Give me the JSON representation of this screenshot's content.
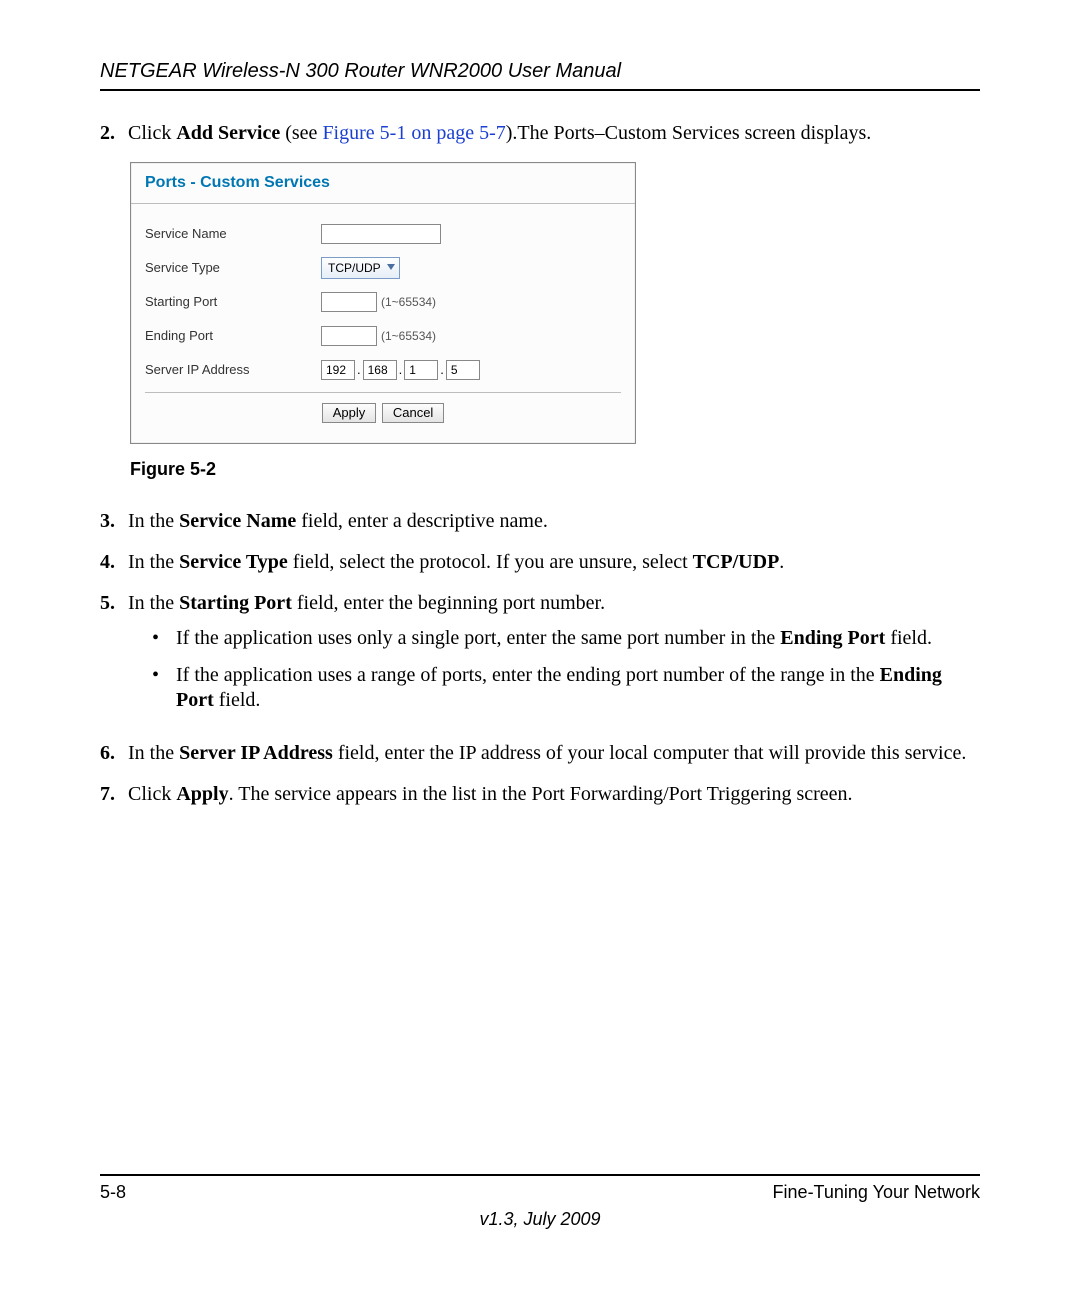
{
  "header": "NETGEAR Wireless-N 300 Router WNR2000 User Manual",
  "steps": {
    "s2": {
      "num": "2.",
      "prefix": "Click ",
      "bold1": "Add Service",
      "mid": " (see ",
      "xref": "Figure 5-1 on page 5-7",
      "suffix": ").The Ports–Custom Services screen displays."
    },
    "s3": {
      "num": "3.",
      "t1": "In the ",
      "b1": "Service Name",
      "t2": " field, enter a descriptive name."
    },
    "s4": {
      "num": "4.",
      "t1": "In the ",
      "b1": "Service Type",
      "t2": " field, select the protocol. If you are unsure, select ",
      "b2": "TCP/UDP",
      "t3": "."
    },
    "s5": {
      "num": "5.",
      "t1": "In the ",
      "b1": "Starting Port",
      "t2": " field, enter the beginning port number.",
      "bullet1": {
        "t1": "If the application uses only a single port, enter the same port number in the ",
        "b1": "Ending Port",
        "t2": " field."
      },
      "bullet2": {
        "t1": "If the application uses a range of ports, enter the ending port number of the range in the ",
        "b1": "Ending Port",
        "t2": " field."
      }
    },
    "s6": {
      "num": "6.",
      "t1": "In the ",
      "b1": "Server IP Address",
      "t2": " field, enter the IP address of your local computer that will provide this service."
    },
    "s7": {
      "num": "7.",
      "t1": "Click ",
      "b1": "Apply",
      "t2": ". The service appears in the list in the Port Forwarding/Port Triggering screen."
    }
  },
  "figure": {
    "caption": "Figure 5-2",
    "title": "Ports - Custom Services",
    "labels": {
      "service_name": "Service Name",
      "service_type": "Service Type",
      "starting_port": "Starting Port",
      "ending_port": "Ending Port",
      "server_ip": "Server IP Address"
    },
    "values": {
      "service_type": "TCP/UDP",
      "port_hint": "(1~65534)",
      "ip1": "192",
      "ip2": "168",
      "ip3": "1",
      "ip4": "5"
    },
    "buttons": {
      "apply": "Apply",
      "cancel": "Cancel"
    }
  },
  "footer": {
    "page": "5-8",
    "section": "Fine-Tuning Your Network",
    "version": "v1.3, July 2009"
  }
}
